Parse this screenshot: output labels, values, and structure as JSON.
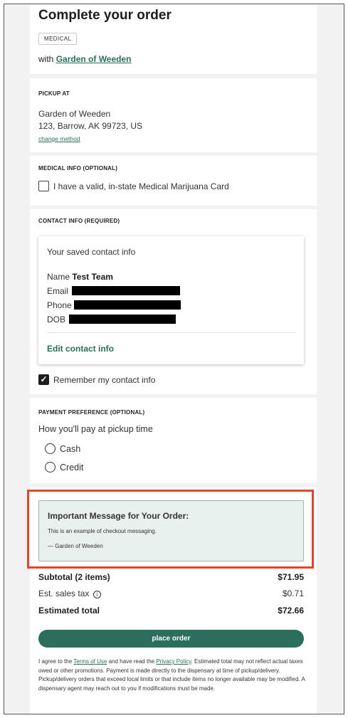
{
  "header": {
    "title": "Complete your order",
    "badge": "MEDICAL",
    "with_prefix": "with",
    "store_link": "Garden of Weeden"
  },
  "pickup": {
    "heading": "PICKUP AT",
    "store_name": "Garden of Weeden",
    "address": "123, Barrow, AK 99723, US",
    "change_link": "change method"
  },
  "medical": {
    "heading": "MEDICAL INFO (OPTIONAL)",
    "checkbox_label": "I have a valid, in-state Medical Marijuana Card",
    "checked": false
  },
  "contact": {
    "heading": "CONTACT INFO (REQUIRED)",
    "saved_title": "Your saved contact info",
    "name_label": "Name",
    "name_value": "Test Team",
    "email_label": "Email",
    "phone_label": "Phone",
    "dob_label": "DOB",
    "edit_link": "Edit contact info",
    "remember_label": "Remember my contact info",
    "remember_checked": true
  },
  "payment": {
    "heading": "PAYMENT PREFERENCE (OPTIONAL)",
    "question": "How you'll pay at pickup time",
    "options": [
      "Cash",
      "Credit"
    ]
  },
  "message": {
    "title": "Important Message for Your Order:",
    "body": "This is an example of checkout messaging.",
    "signature": "— Garden of Weeden"
  },
  "totals": {
    "subtotal_label": "Subtotal (2 items)",
    "subtotal_value": "$71.95",
    "tax_label": "Est. sales tax",
    "tax_value": "$0.71",
    "total_label": "Estimated total",
    "total_value": "$72.66"
  },
  "place_order_label": "place order",
  "legal": {
    "prefix": "I agree to the",
    "terms_link": "Terms of Use",
    "middle": "and have read the",
    "privacy_link": "Privacy Policy",
    "suffix": ". Estimated total may not reflect actual taxes owed or other promotions. Payment is made directly to the dispensary at time of pickup/delivery. Pickup/delivery orders that exceed local limits or that include items no longer available may be modified. A dispensary agent may reach out to you if modifications must be made."
  },
  "colors": {
    "brand_green": "#2c6e5c",
    "message_bg": "#e9f1ef",
    "highlight_red": "#e1452b"
  },
  "icons": {
    "info": "info-icon",
    "check": "checkmark-icon",
    "radio": "radio-icon"
  }
}
